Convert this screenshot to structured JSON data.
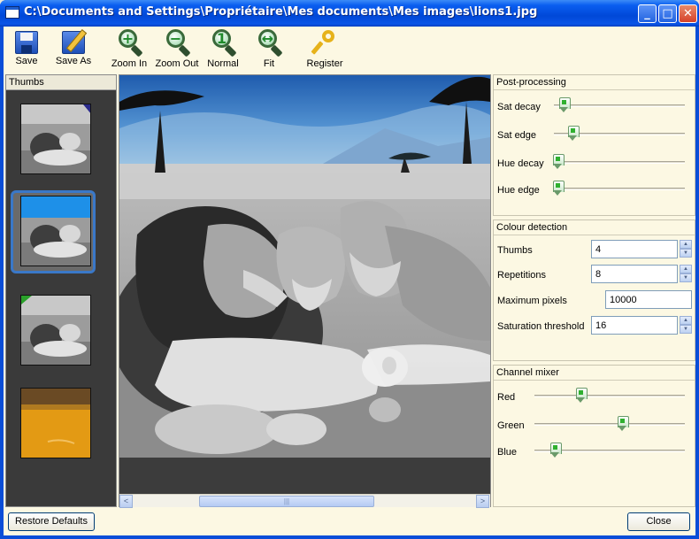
{
  "window": {
    "title": "C:\\Documents and Settings\\Propriétaire\\Mes documents\\Mes images\\lions1.jpg",
    "minimize": "_",
    "maximize": "□",
    "close": "✕"
  },
  "toolbar": {
    "buttons": [
      {
        "label": "Save",
        "icon": "floppy-disk-icon"
      },
      {
        "label": "Save As",
        "icon": "floppy-pencil-icon"
      },
      {
        "label": "Zoom In",
        "icon": "magnifier-plus-icon"
      },
      {
        "label": "Zoom Out",
        "icon": "magnifier-minus-icon"
      },
      {
        "label": "Normal",
        "icon": "magnifier-one-icon"
      },
      {
        "label": "Fit",
        "icon": "magnifier-fit-icon"
      },
      {
        "label": "Register",
        "icon": "key-icon"
      }
    ]
  },
  "thumbs": {
    "header": "Thumbs",
    "selected_index": 1,
    "items": 4
  },
  "post_processing": {
    "title": "Post-processing",
    "sliders": [
      {
        "label": "Sat decay",
        "value": 0.05
      },
      {
        "label": "Sat edge",
        "value": 0.12
      },
      {
        "label": "Hue decay",
        "value": 0.02
      },
      {
        "label": "Hue edge",
        "value": 0.02
      }
    ]
  },
  "colour_detection": {
    "title": "Colour detection",
    "fields": [
      {
        "label": "Thumbs",
        "value": "4"
      },
      {
        "label": "Repetitions",
        "value": "8"
      },
      {
        "label": "Maximum pixels",
        "value": "10000"
      },
      {
        "label": "Saturation threshold",
        "value": "16"
      }
    ]
  },
  "channel_mixer": {
    "title": "Channel mixer",
    "sliders": [
      {
        "label": "Red",
        "value": 0.31
      },
      {
        "label": "Green",
        "value": 0.59
      },
      {
        "label": "Blue",
        "value": 0.11
      }
    ]
  },
  "scrollbar": {
    "left": "<",
    "right": ">",
    "grip": "|||"
  },
  "footer": {
    "restore_label": "Restore Defaults",
    "close_label": "Close"
  }
}
